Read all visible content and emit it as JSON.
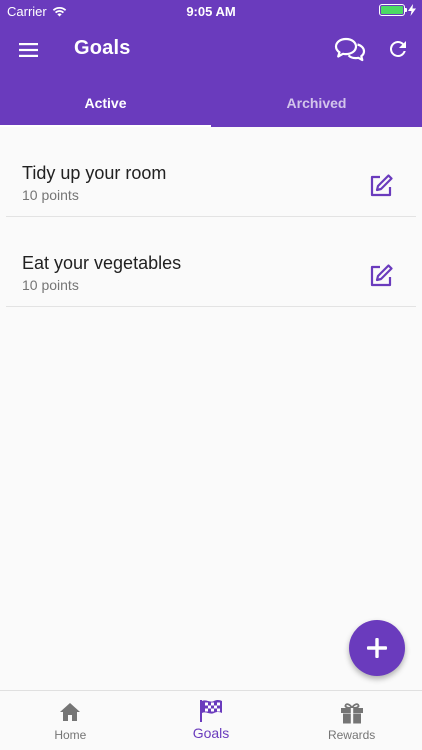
{
  "status_bar": {
    "carrier": "Carrier",
    "time": "9:05 AM",
    "battery_level": 1.0
  },
  "app_bar": {
    "title": "Goals"
  },
  "tabs": [
    {
      "label": "Active",
      "active": true
    },
    {
      "label": "Archived",
      "active": false
    }
  ],
  "goals": [
    {
      "title": "Tidy up your room",
      "points": "10 points"
    },
    {
      "title": "Eat your vegetables",
      "points": "10 points"
    }
  ],
  "bottom_nav": [
    {
      "label": "Home",
      "icon": "home-icon",
      "active": false
    },
    {
      "label": "Goals",
      "icon": "checkered-flag-icon",
      "active": true
    },
    {
      "label": "Rewards",
      "icon": "gift-icon",
      "active": false
    }
  ],
  "colors": {
    "primary": "#6a3bbd",
    "background": "#fafafa",
    "battery": "#4cd964"
  }
}
